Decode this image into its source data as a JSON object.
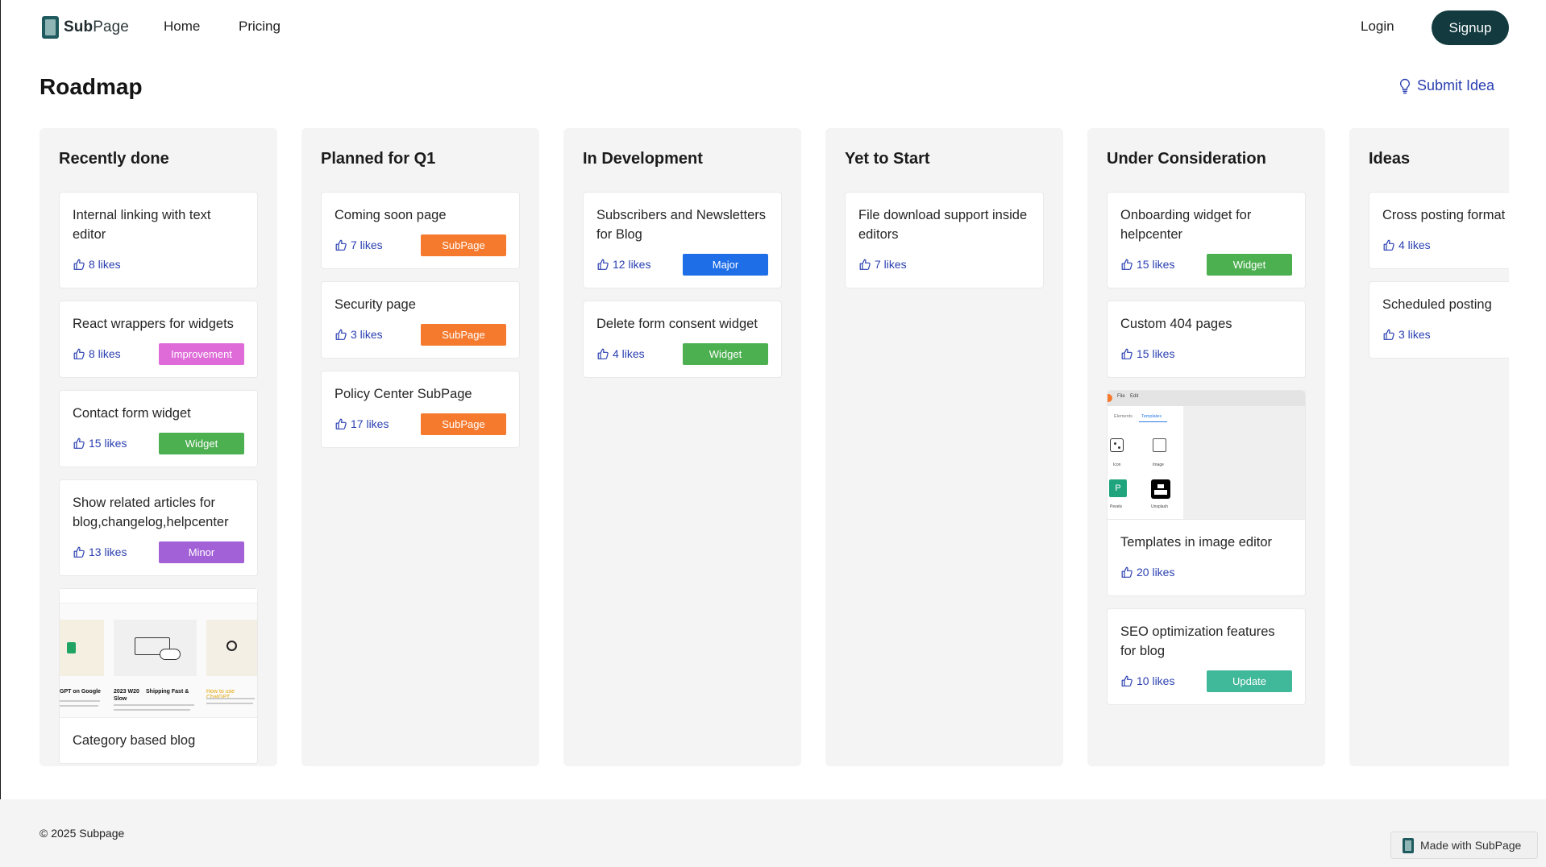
{
  "header": {
    "logo_bold": "Sub",
    "logo_rest": "Page",
    "nav": [
      "Home",
      "Pricing"
    ],
    "login": "Login",
    "signup": "Signup"
  },
  "page": {
    "title": "Roadmap",
    "submit_idea": "Submit Idea"
  },
  "colors": {
    "accent_blue": "#2a3fb0",
    "signup_bg": "#123a3f",
    "tag_subpage": "#f57a2e",
    "tag_improvement": "#df6bd8",
    "tag_widget": "#4caf50",
    "tag_minor": "#a361d8",
    "tag_major": "#1e6ee8",
    "tag_update": "#40b89a"
  },
  "columns": [
    {
      "title": "Recently done",
      "cards": [
        {
          "title": "Internal linking with text editor",
          "likes": "8 likes",
          "tag": ""
        },
        {
          "title": "React wrappers for widgets",
          "likes": "8 likes",
          "tag": "Improvement",
          "tag_color": "#df6bd8"
        },
        {
          "title": "Contact form widget",
          "likes": "15 likes",
          "tag": "Widget",
          "tag_color": "#4caf50"
        },
        {
          "title": "Show related articles for blog,changelog,helpcenter",
          "likes": "13 likes",
          "tag": "Minor",
          "tag_color": "#a361d8"
        },
        {
          "title": "Category based blog",
          "likes": "",
          "tag": "",
          "image": "blog-preview",
          "image_text": [
            "GPT on Google",
            "2023 W20",
            "Shipping Fast &",
            "Slow",
            "How to use ChatGPT"
          ]
        }
      ]
    },
    {
      "title": "Planned for Q1",
      "cards": [
        {
          "title": "Coming soon page",
          "likes": "7 likes",
          "tag": "SubPage",
          "tag_color": "#f57a2e"
        },
        {
          "title": "Security page",
          "likes": "3 likes",
          "tag": "SubPage",
          "tag_color": "#f57a2e"
        },
        {
          "title": "Policy Center SubPage",
          "likes": "17 likes",
          "tag": "SubPage",
          "tag_color": "#f57a2e"
        }
      ]
    },
    {
      "title": "In Development",
      "cards": [
        {
          "title": "Subscribers and Newsletters for Blog",
          "likes": "12 likes",
          "tag": "Major",
          "tag_color": "#1e6ee8"
        },
        {
          "title": "Delete form consent widget",
          "likes": "4 likes",
          "tag": "Widget",
          "tag_color": "#4caf50"
        }
      ]
    },
    {
      "title": "Yet to Start",
      "cards": [
        {
          "title": "File download support inside editors",
          "likes": "7 likes",
          "tag": ""
        }
      ]
    },
    {
      "title": "Under Consideration",
      "cards": [
        {
          "title": "Onboarding widget for helpcenter",
          "likes": "15 likes",
          "tag": "Widget",
          "tag_color": "#4caf50"
        },
        {
          "title": "Custom 404 pages",
          "likes": "15 likes",
          "tag": ""
        },
        {
          "title": "Templates in image editor",
          "likes": "20 likes",
          "tag": "",
          "image": "image-editor",
          "image_text": [
            "File",
            "Edit",
            "Elements",
            "Templates",
            "Icon",
            "Image",
            "Pexels",
            "Unsplash"
          ]
        },
        {
          "title": "SEO optimization features for blog",
          "likes": "10 likes",
          "tag": "Update",
          "tag_color": "#40b89a"
        }
      ]
    },
    {
      "title": "Ideas",
      "cards": [
        {
          "title": "Cross posting format",
          "likes": "4 likes",
          "tag": ""
        },
        {
          "title": "Scheduled posting",
          "likes": "3 likes",
          "tag": ""
        }
      ]
    }
  ],
  "footer": {
    "copyright": "© 2025 Subpage",
    "made_with": "Made with SubPage"
  }
}
